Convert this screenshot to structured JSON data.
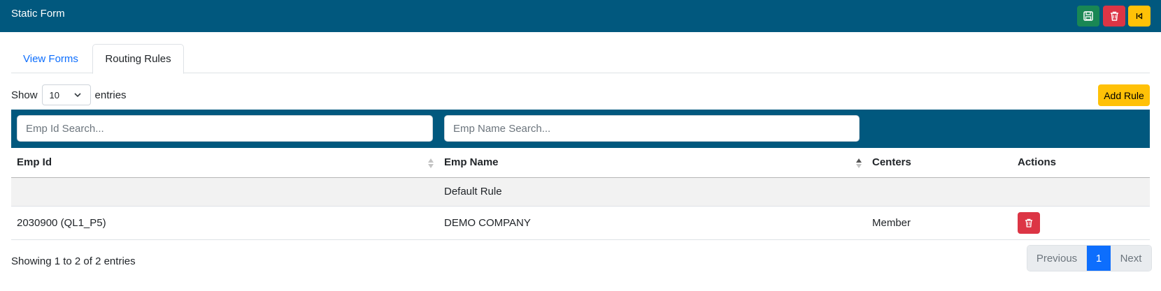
{
  "header": {
    "title": "Static Form",
    "save_icon": "save-icon",
    "delete_icon": "trash-icon",
    "back_icon": "skip-back-icon"
  },
  "tabs": [
    {
      "label": "View Forms",
      "active": false
    },
    {
      "label": "Routing Rules",
      "active": true
    }
  ],
  "length_control": {
    "prefix": "Show",
    "selected": "10",
    "suffix": "entries"
  },
  "add_rule_label": "Add Rule",
  "search": {
    "emp_id_placeholder": "Emp Id Search...",
    "emp_name_placeholder": "Emp Name Search..."
  },
  "table": {
    "columns": [
      "Emp Id",
      "Emp Name",
      "Centers",
      "Actions"
    ],
    "rows": [
      {
        "emp_id": "",
        "emp_name": "Default Rule",
        "centers": "",
        "has_delete": false
      },
      {
        "emp_id": "2030900 (QL1_P5)",
        "emp_name": "DEMO COMPANY",
        "centers": "Member",
        "has_delete": true
      }
    ]
  },
  "footer": {
    "info": "Showing 1 to 2 of 2 entries",
    "previous": "Previous",
    "current_page": "1",
    "next": "Next"
  },
  "colors": {
    "brand": "#01587e",
    "save": "#198754",
    "danger": "#dc3545",
    "warning": "#ffc107",
    "primary": "#0d6efd"
  }
}
